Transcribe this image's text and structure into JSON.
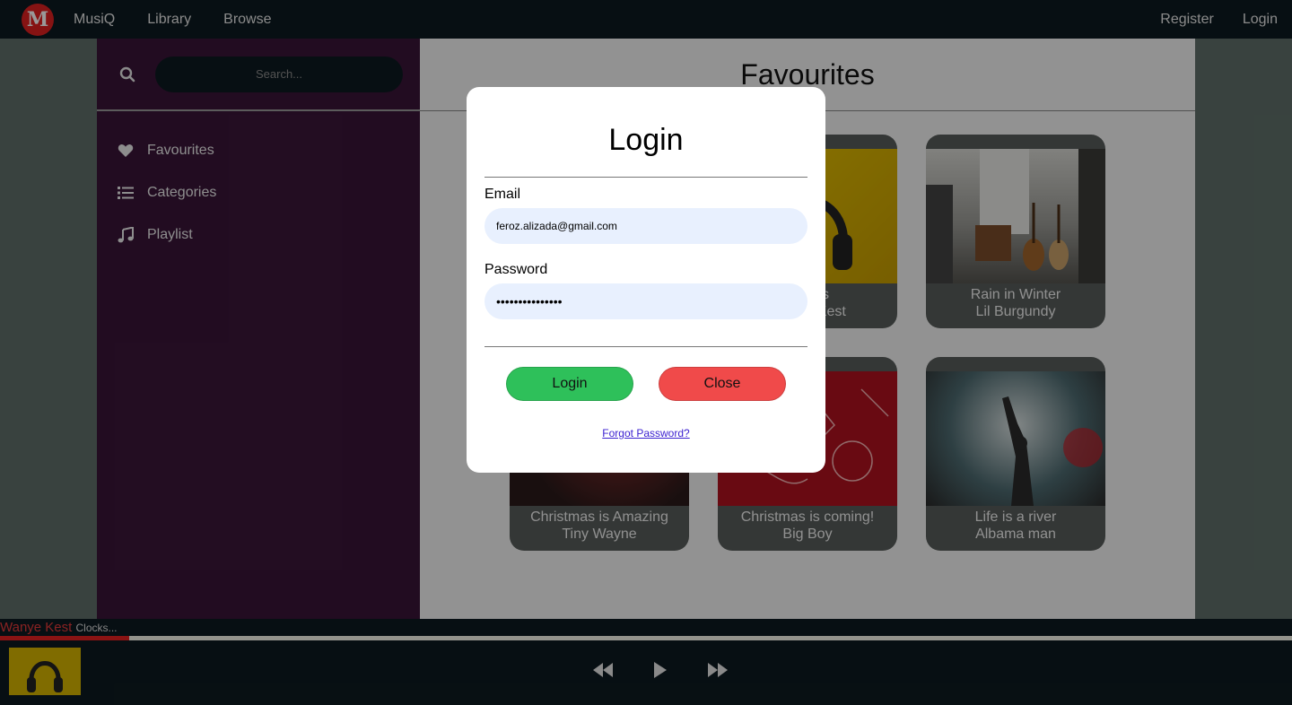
{
  "nav": {
    "logo_letter": "M",
    "brand": "MusiQ",
    "links": [
      "Library",
      "Browse"
    ],
    "register": "Register",
    "login": "Login"
  },
  "sidebar": {
    "search_placeholder": "Search...",
    "items": [
      {
        "label": "Favourites",
        "icon": "heart-icon"
      },
      {
        "label": "Categories",
        "icon": "list-icon"
      },
      {
        "label": "Playlist",
        "icon": "music-note-icon"
      }
    ]
  },
  "main": {
    "title": "Favourites",
    "cards": [
      {
        "title": "Clocks",
        "artist": "Wanye Kest"
      },
      {
        "title": "Rain in Winter",
        "artist": "Lil Burgundy"
      },
      {
        "title": "Christmas is Amazing",
        "artist": "Tiny Wayne"
      },
      {
        "title": "Christmas is coming!",
        "artist": "Big Boy"
      },
      {
        "title": "Life is a river",
        "artist": "Albama man"
      }
    ]
  },
  "player": {
    "artist": "Wanye Kest",
    "song": "Clocks...",
    "progress": 0.1
  },
  "modal": {
    "title": "Login",
    "email_label": "Email",
    "email_value": "feroz.alizada@gmail.com",
    "password_label": "Password",
    "password_value": "•••••••••••••••",
    "login_button": "Login",
    "close_button": "Close",
    "forgot": "Forgot Password?"
  },
  "colors": {
    "nav_bg": "#0d1a20",
    "sidebar_bg": "#3a1538",
    "login_btn": "#2ec05a",
    "close_btn": "#f04a4a",
    "accent_red": "#e62020"
  }
}
